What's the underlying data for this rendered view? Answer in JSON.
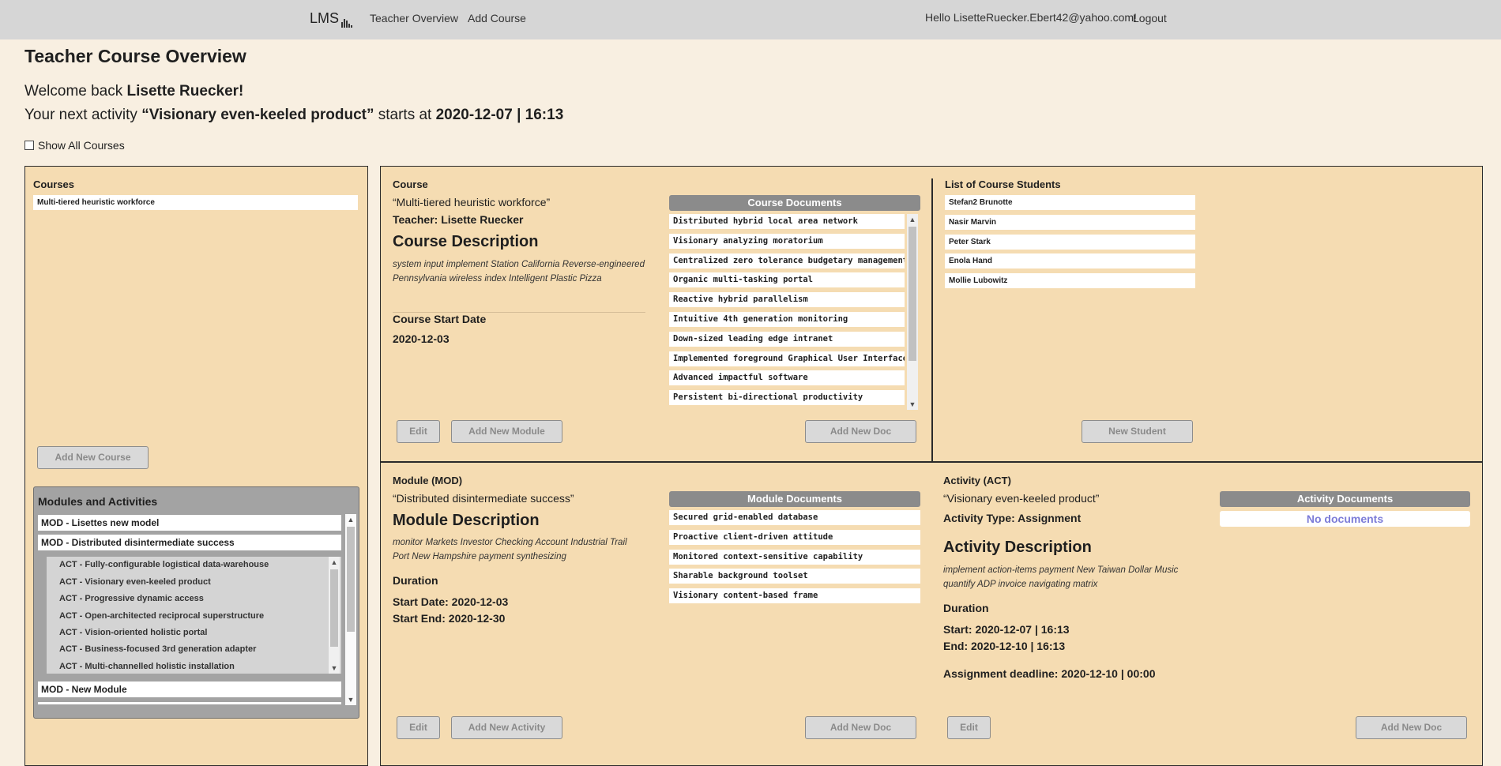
{
  "nav": {
    "brand": "LMS",
    "links": [
      "Teacher Overview",
      "Add Course"
    ],
    "hello": "Hello LisetteRuecker.Ebert42@yahoo.com!",
    "logout": "Logout"
  },
  "header": {
    "title": "Teacher Course Overview",
    "welcome_prefix": "Welcome back ",
    "welcome_name": "Lisette Ruecker!",
    "next_prefix": "Your next activity ",
    "next_activity": "“Visionary even-keeled product”",
    "next_mid": " starts at ",
    "next_date": "2020-12-07 | 16:13",
    "show_all": "Show All Courses"
  },
  "courses": {
    "title": "Courses",
    "items": [
      "Multi-tiered heuristic workforce"
    ],
    "add_button": "Add New Course"
  },
  "modules_activities": {
    "title": "Modules and Activities",
    "modules": [
      "MOD - Lisettes new model",
      "MOD - Distributed disintermediate success",
      "MOD - New Module"
    ],
    "activities": [
      "ACT - Fully-configurable logistical data-warehouse",
      "ACT - Visionary even-keeled product",
      "ACT - Progressive dynamic access",
      "ACT - Open-architected reciprocal superstructure",
      "ACT - Vision-oriented holistic portal",
      "ACT - Business-focused 3rd generation adapter",
      "ACT - Multi-channelled holistic installation"
    ]
  },
  "course": {
    "label": "Course",
    "name": "“Multi-tiered heuristic workforce”",
    "teacher": "Teacher: Lisette Ruecker",
    "desc_title": "Course Description",
    "description": "system input implement Station California Reverse-engineered Pennsylvania wireless index Intelligent Plastic Pizza",
    "start_label": "Course Start Date",
    "start_date": "2020-12-03",
    "docs_title": "Course Documents",
    "docs": [
      "Distributed hybrid local area network",
      "Visionary analyzing moratorium",
      "Centralized zero tolerance budgetary management",
      "Organic multi-tasking portal",
      "Reactive hybrid parallelism",
      "Intuitive 4th generation monitoring",
      "Down-sized leading edge intranet",
      "Implemented foreground Graphical User Interface",
      "Advanced impactful software",
      "Persistent bi-directional productivity"
    ],
    "edit": "Edit",
    "add_module": "Add New Module",
    "add_doc": "Add New Doc"
  },
  "students": {
    "title": "List of Course Students",
    "items": [
      "Stefan2 Brunotte",
      "Nasir Marvin",
      "Peter Stark",
      "Enola Hand",
      "Mollie Lubowitz"
    ],
    "new_button": "New Student"
  },
  "module": {
    "label": "Module (MOD)",
    "name": "“Distributed disintermediate success”",
    "desc_title": "Module Description",
    "description": "monitor Markets Investor Checking Account Industrial Trail Port New Hampshire payment synthesizing",
    "duration_label": "Duration",
    "start": "Start Date: 2020-12-03",
    "end": "Start End: 2020-12-30",
    "docs_title": "Module Documents",
    "docs": [
      "Secured grid-enabled database",
      "Proactive client-driven attitude",
      "Monitored context-sensitive capability",
      "Sharable background toolset",
      "Visionary content-based frame"
    ],
    "edit": "Edit",
    "add_activity": "Add New Activity",
    "add_doc": "Add New Doc"
  },
  "activity": {
    "label": "Activity (ACT)",
    "name": "“Visionary even-keeled product”",
    "type": "Activity Type: Assignment",
    "desc_title": "Activity Description",
    "description": "implement action-items payment New Taiwan Dollar Music quantify ADP invoice navigating matrix",
    "duration_label": "Duration",
    "start": "Start: 2020-12-07 | 16:13",
    "end": "End: 2020-12-10 | 16:13",
    "deadline": "Assignment deadline: 2020-12-10 | 00:00",
    "docs_title": "Activity Documents",
    "no_docs": "No documents",
    "edit": "Edit",
    "add_doc": "Add New Doc"
  }
}
